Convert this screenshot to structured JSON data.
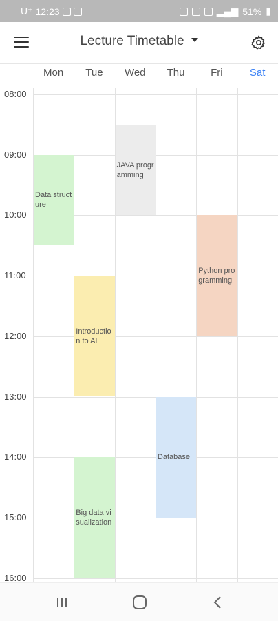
{
  "status": {
    "carrier": "U⁺",
    "time": "12:23",
    "battery": "51%"
  },
  "header": {
    "title": "Lecture Timetable"
  },
  "days": [
    {
      "label": "Mon",
      "color": "#555555"
    },
    {
      "label": "Tue",
      "color": "#555555"
    },
    {
      "label": "Wed",
      "color": "#555555"
    },
    {
      "label": "Thu",
      "color": "#555555"
    },
    {
      "label": "Fri",
      "color": "#555555"
    },
    {
      "label": "Sat",
      "color": "#3b82f6"
    }
  ],
  "times": [
    "08:00",
    "09:00",
    "10:00",
    "11:00",
    "12:00",
    "13:00",
    "14:00",
    "15:00",
    "16:00"
  ],
  "courses": [
    {
      "name": "Data structure",
      "day": 0,
      "start": 9.0,
      "end": 10.5,
      "color": "#d4f4d0"
    },
    {
      "name": "JAVA programming",
      "day": 2,
      "start": 8.5,
      "end": 10.0,
      "color": "#ececec"
    },
    {
      "name": "Python programming",
      "day": 4,
      "start": 10.0,
      "end": 12.0,
      "color": "#f5d5c2"
    },
    {
      "name": "Introduction to AI",
      "day": 1,
      "start": 11.0,
      "end": 13.0,
      "color": "#fbedb0"
    },
    {
      "name": "Database",
      "day": 3,
      "start": 13.0,
      "end": 15.0,
      "color": "#d5e6f8"
    },
    {
      "name": "Big data visualization",
      "day": 1,
      "start": 14.0,
      "end": 16.0,
      "color": "#d4f4d0"
    }
  ]
}
